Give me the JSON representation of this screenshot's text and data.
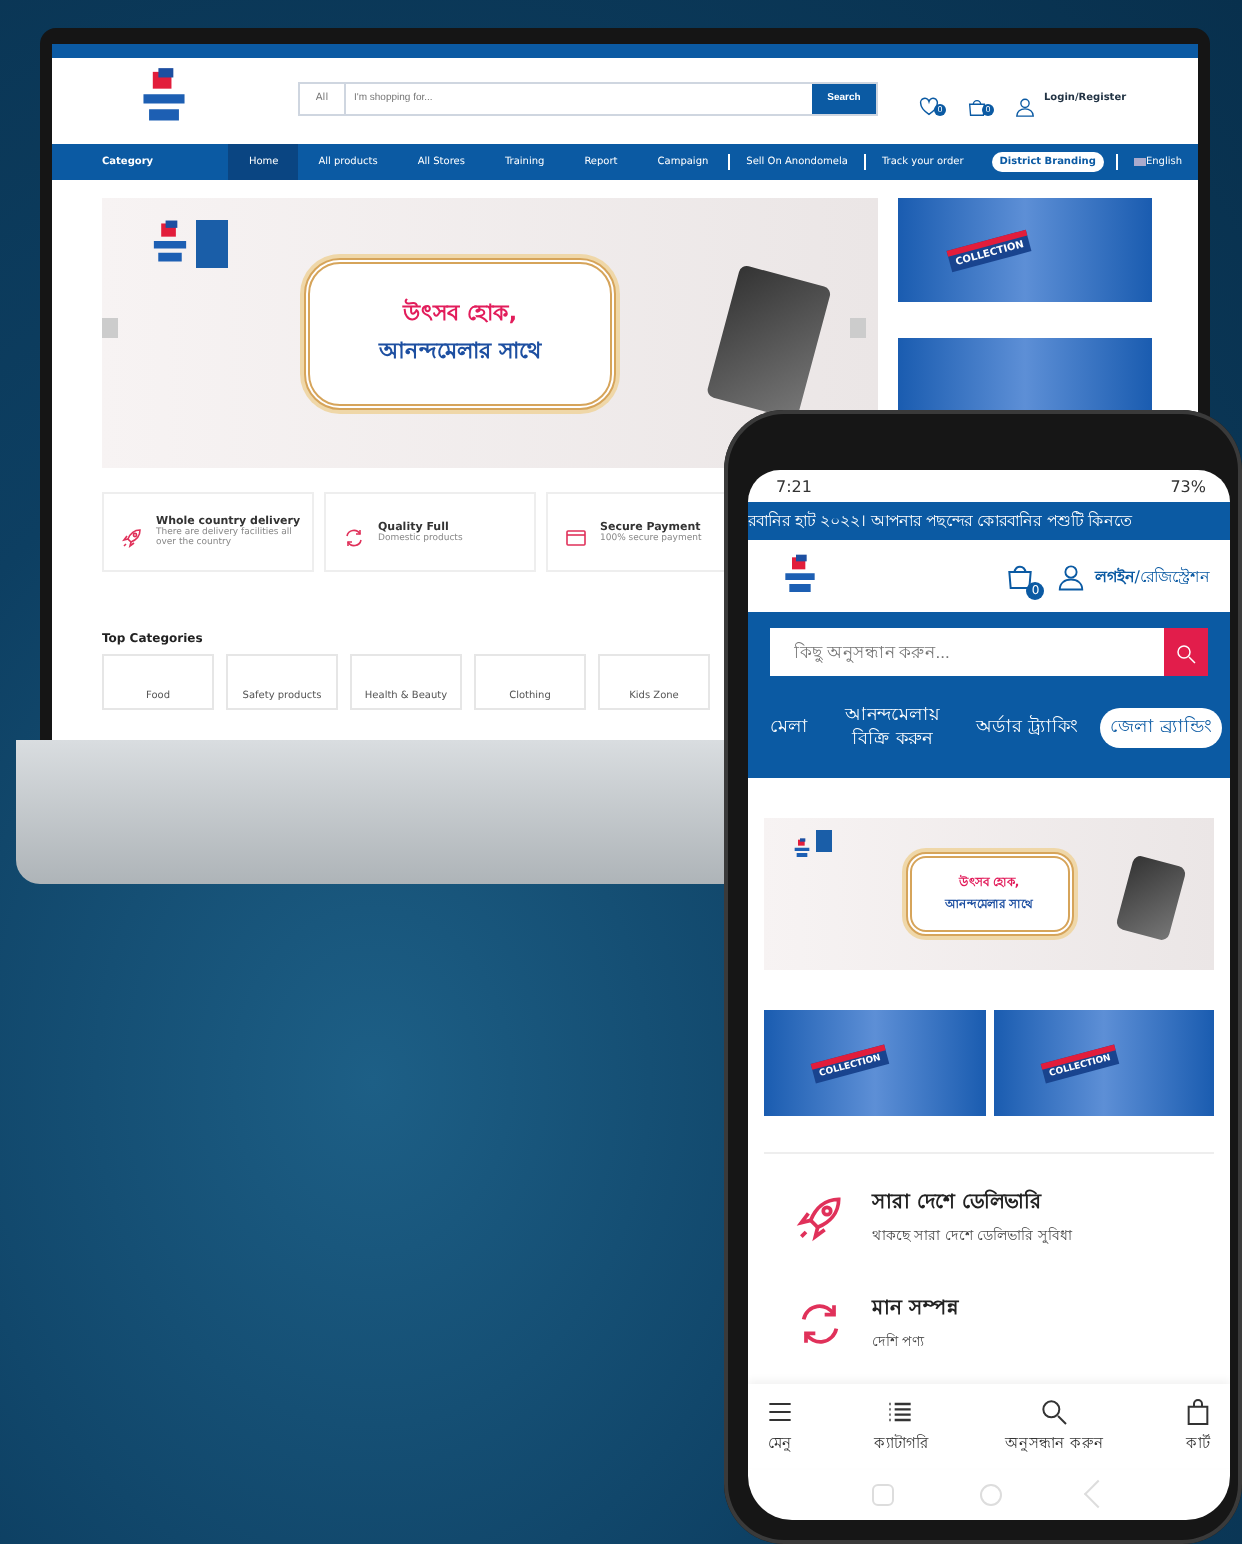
{
  "desktop": {
    "header": {
      "search": {
        "category": "All",
        "placeholder": "I'm shopping for...",
        "button": "Search"
      },
      "wishlist_count": "0",
      "cart_count": "0",
      "login": "Login/Register"
    },
    "category_button": "Category",
    "nav": [
      {
        "label": "Home",
        "selected": true,
        "kind": "link"
      },
      {
        "label": "All products",
        "selected": false,
        "kind": "link"
      },
      {
        "label": "All Stores",
        "selected": false,
        "kind": "link"
      },
      {
        "label": "Training",
        "selected": false,
        "kind": "link"
      },
      {
        "label": "Report",
        "selected": false,
        "kind": "link"
      },
      {
        "label": "Campaign",
        "selected": false,
        "kind": "link"
      },
      {
        "label": "Sell On Anondomela",
        "selected": false,
        "kind": "divided"
      },
      {
        "label": "Track your order",
        "selected": false,
        "kind": "divided"
      },
      {
        "label": "District Branding",
        "selected": false,
        "kind": "pill"
      },
      {
        "label": "English",
        "selected": false,
        "kind": "language"
      }
    ],
    "banner": {
      "line_1": "উৎসব হোক,",
      "line_2": "আনন্দমেলার সাথে"
    },
    "promo": {
      "tag": "COLLECTION"
    },
    "features": [
      {
        "title": "Whole country delivery",
        "subtitle": "There are delivery facilities all over the country",
        "kind": "rocket"
      },
      {
        "title": "Quality Full",
        "subtitle": "Domestic products",
        "kind": "cycle"
      },
      {
        "title": "Secure Payment",
        "subtitle": "100% secure payment",
        "kind": "card"
      }
    ],
    "top_categories": {
      "title": "Top Categories",
      "items": [
        "Food",
        "Safety products",
        "Health & Beauty",
        "Clothing",
        "Kids Zone"
      ]
    }
  },
  "phone": {
    "status": {
      "time": "7:21",
      "battery": "73%"
    },
    "ticker": "রবানির হাট ২০২২। আপনার পছন্দের কোরবানির পশুটি কিনতে",
    "cart_count": "0",
    "login": "**লগইন**/রেজিস্ট্রেশন",
    "search": {
      "placeholder": "কিছু অনুসন্ধান করুন..."
    },
    "nav": [
      {
        "label": "মেলা",
        "selected": false
      },
      {
        "label": "আনন্দমেলায় বিক্রি করুন",
        "selected": false
      },
      {
        "label": "অর্ডার ট্র্যাকিং",
        "selected": false
      },
      {
        "label": "জেলা ব্র্যান্ডিং",
        "selected": true
      }
    ],
    "banner": {
      "line_1": "উৎসব হোক,",
      "line_2": "আনন্দমেলার সাথে"
    },
    "promos": [
      {
        "tag": "COLLECTION"
      },
      {
        "tag": "COLLECTION"
      }
    ],
    "features": [
      {
        "title": "সারা দেশে ডেলিভারি",
        "subtitle": "থাকছে সারা দেশে ডেলিভারি সুবিধা",
        "kind": "rocket"
      },
      {
        "title": "মান সম্পন্ন",
        "subtitle": "দেশি পণ্য",
        "kind": "cycle"
      }
    ],
    "bottom_nav": [
      {
        "label": "মেনু",
        "kind": "menu"
      },
      {
        "label": "ক্যাটাগরি",
        "kind": "list"
      },
      {
        "label": "অনুসন্ধান করুন",
        "kind": "search"
      },
      {
        "label": "কার্ট",
        "kind": "cart"
      }
    ]
  }
}
